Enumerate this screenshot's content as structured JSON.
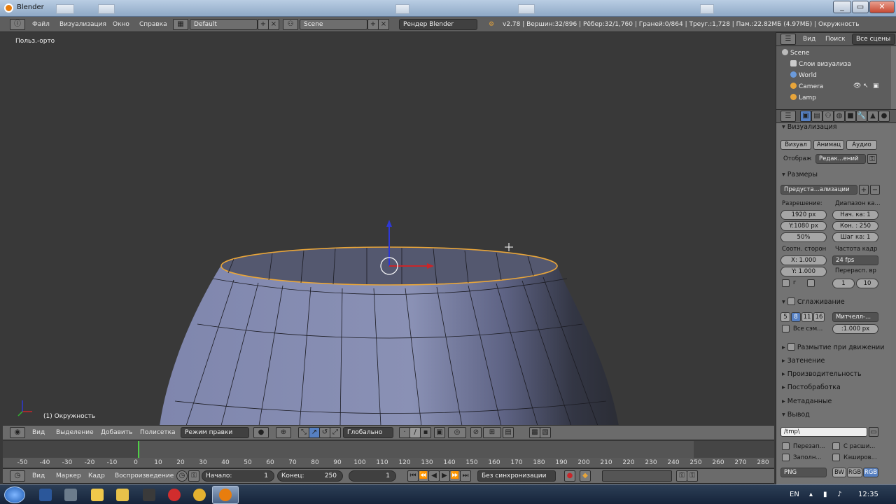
{
  "window": {
    "title": "Blender"
  },
  "topbar": {
    "menus": [
      "Файл",
      "Визуализация",
      "Окно",
      "Справка"
    ],
    "layout": "Default",
    "scene": "Scene",
    "engine": "Рендер Blender",
    "stats": "v2.78 | Вершин:32/896 | Рёбер:32/1,760 | Граней:0/864 | Треуг.:1,728 | Пам.:22.82МБ (4.97МБ) | Окружность"
  },
  "viewport": {
    "view_label": "Польз.-орто",
    "object_label": "(1) Окружность"
  },
  "view3d_header": {
    "menus": [
      "Вид",
      "Выделение",
      "Добавить",
      "Полисетка"
    ],
    "mode": "Режим правки",
    "orientation": "Глобально"
  },
  "timeline": {
    "ruler": [
      "-50",
      "-40",
      "-30",
      "-20",
      "-10",
      "0",
      "10",
      "20",
      "30",
      "40",
      "50",
      "60",
      "70",
      "80",
      "90",
      "100",
      "110",
      "120",
      "130",
      "140",
      "150",
      "160",
      "170",
      "180",
      "190",
      "200",
      "210",
      "220",
      "230",
      "240",
      "250",
      "260",
      "270",
      "280"
    ],
    "menus": [
      "Вид",
      "Маркер",
      "Кадр",
      "Воспроизведение"
    ],
    "start_label": "Начало:",
    "start_value": "1",
    "end_label": "Конец:",
    "end_value": "250",
    "current": "1",
    "sync": "Без синхронизации"
  },
  "outliner": {
    "menus": [
      "Вид",
      "Поиск"
    ],
    "filter": "Все сцены",
    "items": [
      "Scene",
      "Слои визуализа",
      "World",
      "Camera",
      "Lamp"
    ]
  },
  "properties": {
    "render_section": "Визуализация",
    "render_buttons": [
      "Визуал",
      "Анимац",
      "Аудио"
    ],
    "display_label": "Отображ",
    "display_value": "Редак...ений",
    "dimensions_section": "Размеры",
    "preset": "Предуста...ализации",
    "resolution_label": "Разрешение:",
    "res_x": "1920 px",
    "res_y": "Y:1080 px",
    "res_pct": "50%",
    "frame_range_label": "Диапазон ка...",
    "frame_start": "Нач. ка: 1",
    "frame_end": "Кон. : 250",
    "frame_step": "Шаг ка: 1",
    "aspect_label": "Соотн. сторон",
    "aspect_x_label": "X:",
    "aspect_x": "1.000",
    "aspect_y_label": "Y:",
    "aspect_y": "1.000",
    "fps_label": "Частота кадр",
    "fps": "24 fps",
    "remap_label": "Перерасп. вр",
    "remap_old": "1",
    "remap_new": "10",
    "border_char": "г",
    "aa_section": "Сглаживание",
    "aa_samples": [
      "5",
      "8",
      "11",
      "16"
    ],
    "aa_filter": "Митчелл-...",
    "full_sample": "Все сэм...",
    "filter_size": ":1.000 px",
    "motion_blur": "Размытие при движении",
    "shading": "Затенение",
    "performance": "Производительность",
    "postprocessing": "Постобработка",
    "metadata": "Метаданные",
    "output": "Вывод",
    "output_path": "/tmp\\",
    "overwrite": "Перезап...",
    "extensions": "С расши...",
    "placeholders": "Заполн...",
    "cache": "Кэширов...",
    "format": "PNG",
    "color_modes": [
      "BW",
      "RGB",
      "RGB"
    ]
  },
  "taskbar": {
    "lang": "EN",
    "time": "12:35"
  },
  "colors": {
    "selected_edge": "#e8a53a",
    "mesh": "#8c93b8",
    "accent": "#5680c2"
  }
}
